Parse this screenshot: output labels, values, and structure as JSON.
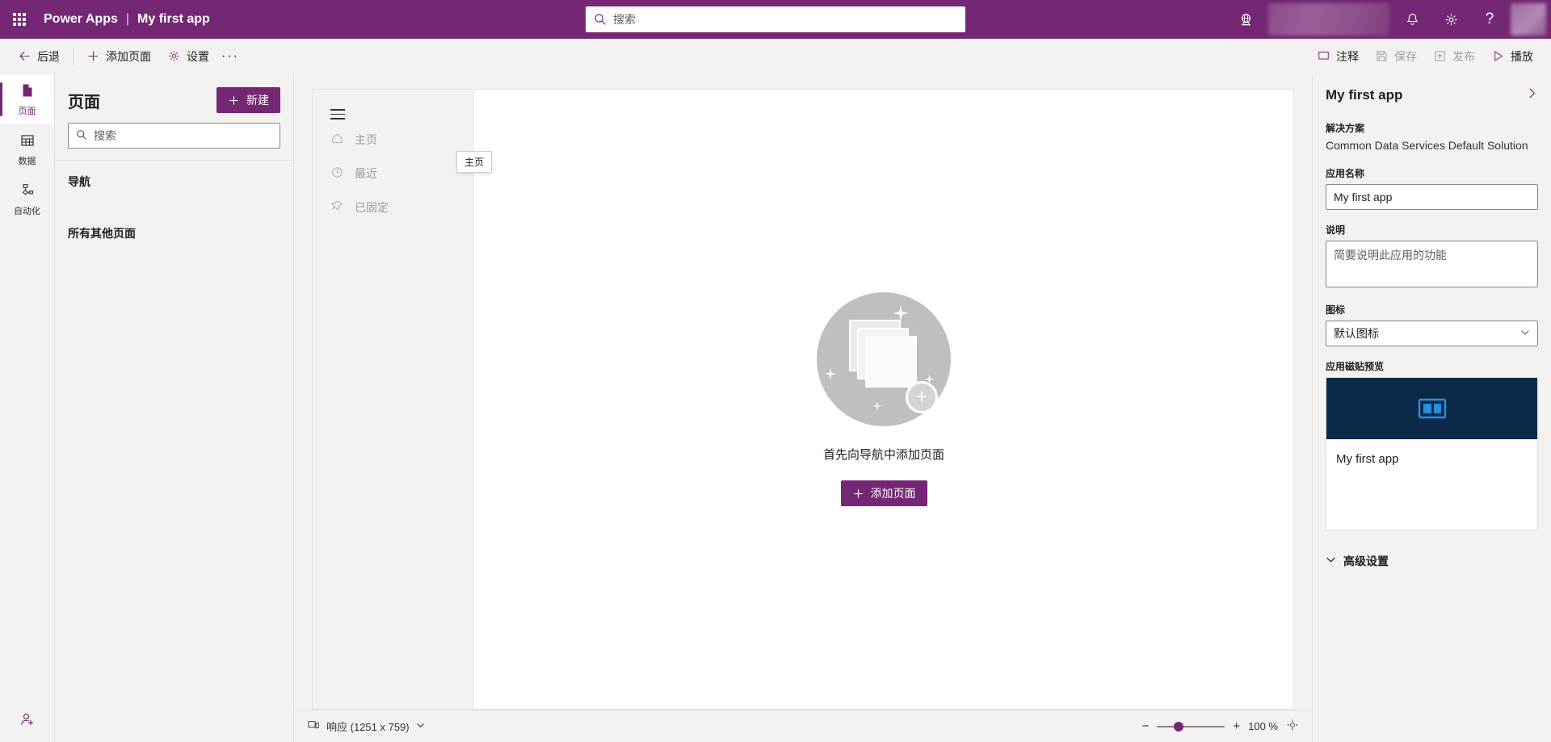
{
  "header": {
    "waffle_label": "app-launcher",
    "brand": "Power Apps",
    "separator": "|",
    "app_name": "My first app",
    "search_placeholder": "搜索",
    "search_value": "",
    "icons": {
      "globe": "globe-icon",
      "bell": "notifications-icon",
      "gear": "settings-icon",
      "help": "?"
    }
  },
  "toolbar": {
    "back": "后退",
    "add_page": "添加页面",
    "settings": "设置",
    "more": "···",
    "comments": "注释",
    "save": "保存",
    "publish": "发布",
    "play": "播放"
  },
  "rail": {
    "items": [
      {
        "label": "页面",
        "icon": "page-icon",
        "active": true
      },
      {
        "label": "数据",
        "icon": "table-icon",
        "active": false
      },
      {
        "label": "自动化",
        "icon": "flow-icon",
        "active": false
      }
    ],
    "bottom_icon": "user-account-icon"
  },
  "pages_panel": {
    "title": "页面",
    "new_button": "新建",
    "search_placeholder": "搜索",
    "search_value": "",
    "nav_section": "导航",
    "other_section": "所有其他页面"
  },
  "preview": {
    "nav_items": [
      {
        "label": "主页",
        "icon": "home-icon"
      },
      {
        "label": "最近",
        "icon": "clock-icon"
      },
      {
        "label": "已固定",
        "icon": "pin-icon"
      }
    ],
    "tooltip": "主页",
    "empty_text": "首先向导航中添加页面",
    "empty_button": "添加页面"
  },
  "statusbar": {
    "layout_label": "响应 (1251 x 759)",
    "zoom_out": "−",
    "zoom_in": "+",
    "zoom_level": "100 %",
    "fit_label": "fit-to-screen-icon"
  },
  "properties": {
    "title": "My first app",
    "expand_icon": "chevron-right-icon",
    "solution_label": "解决方案",
    "solution_value": "Common Data Services Default Solution",
    "app_name_label": "应用名称",
    "app_name_value": "My first app",
    "description_label": "说明",
    "description_value": "",
    "description_placeholder": "简要说明此应用的功能",
    "icon_label": "图标",
    "icon_value": "默认图标",
    "tile_label": "应用磁贴预览",
    "tile_app_name": "My first app",
    "advanced_label": "高级设置"
  },
  "colors": {
    "brand_purple": "#742774",
    "header_purple": "#742774",
    "tile_dark": "#0b2a4a",
    "tile_accent": "#2a8fe0"
  }
}
